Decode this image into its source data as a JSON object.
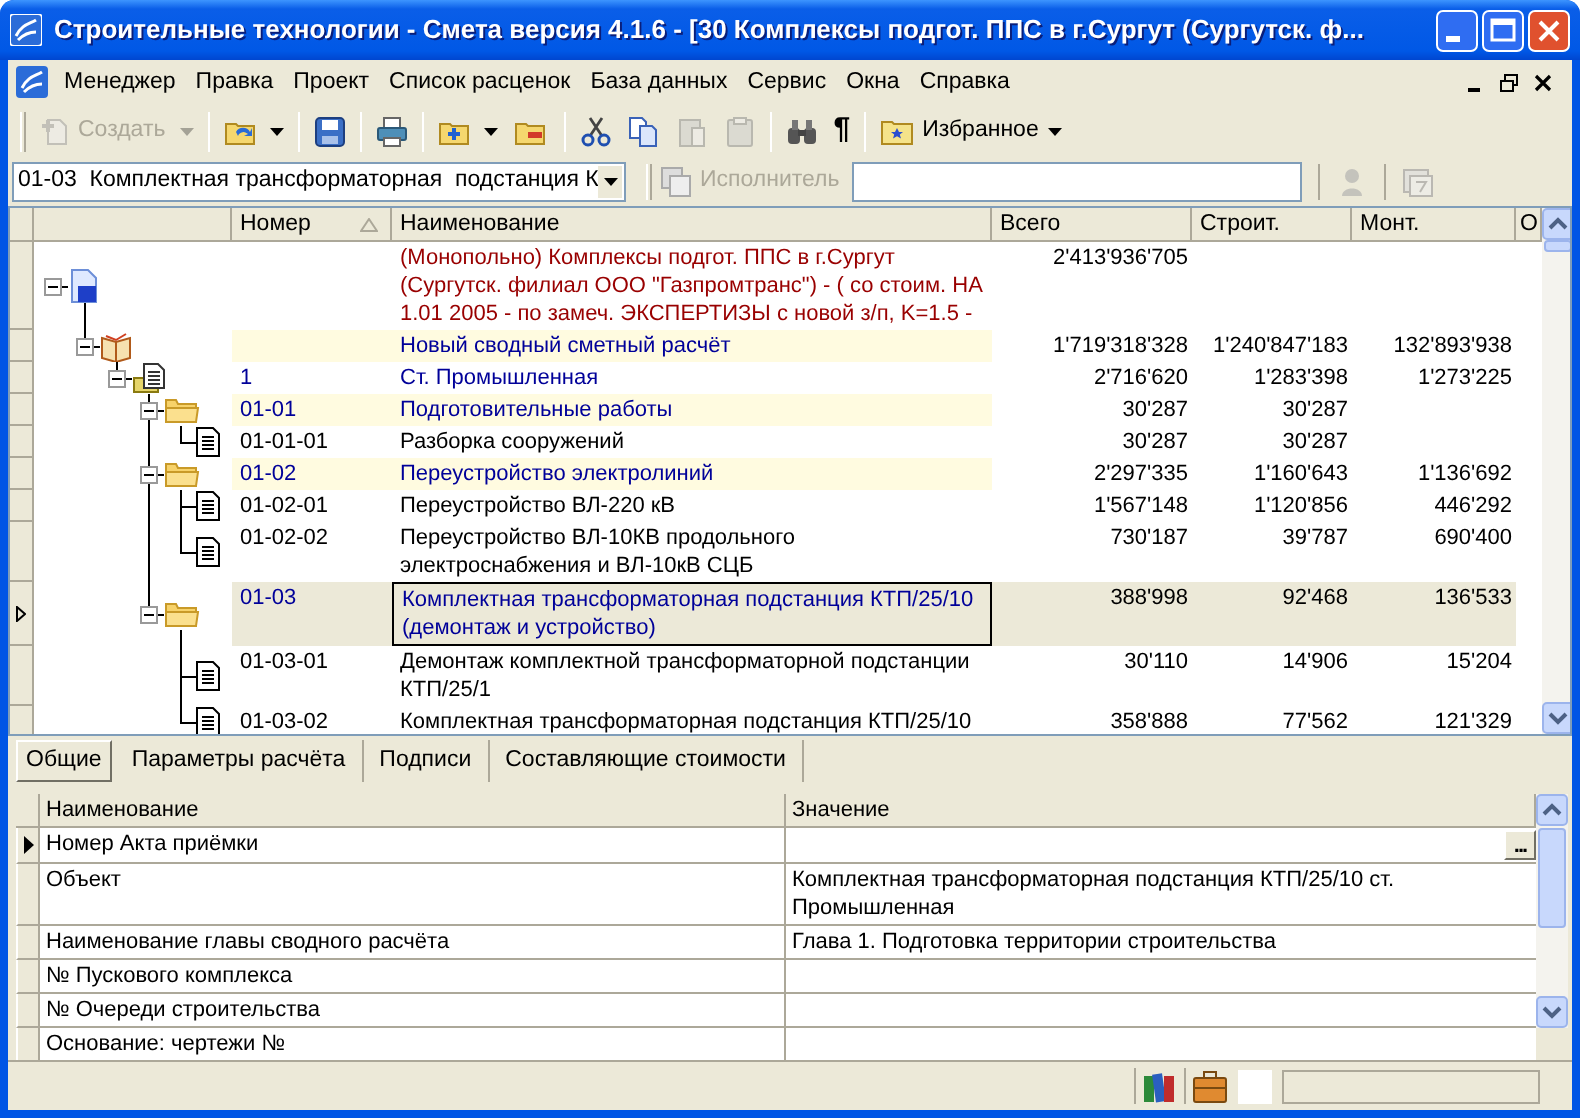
{
  "window": {
    "title": "Строительные технологии - Смета  версия 4.1.6 - [30  Комплексы  подгот. ППС в г.Сургут  (Сургутск. ф..."
  },
  "menu": [
    "Менеджер",
    "Правка",
    "Проект",
    "Список расценок",
    "База данных",
    "Сервис",
    "Окна",
    "Справка"
  ],
  "toolbar": [
    {
      "kind": "create",
      "label": "Создать",
      "disabled": true,
      "dropdown": true
    },
    {
      "kind": "separator"
    },
    {
      "kind": "open",
      "disabled": false,
      "dropdown": true
    },
    {
      "kind": "separator"
    },
    {
      "kind": "save",
      "disabled": false,
      "dropdown": false
    },
    {
      "kind": "separator"
    },
    {
      "kind": "print",
      "disabled": false,
      "dropdown": false
    },
    {
      "kind": "separator"
    },
    {
      "kind": "add",
      "disabled": false,
      "dropdown": true
    },
    {
      "kind": "folder",
      "disabled": false,
      "dropdown": false
    },
    {
      "kind": "separator"
    },
    {
      "kind": "cut",
      "disabled": false,
      "dropdown": false
    },
    {
      "kind": "copy",
      "disabled": false,
      "dropdown": false
    },
    {
      "kind": "paste",
      "disabled": true,
      "dropdown": false
    },
    {
      "kind": "clipboard",
      "disabled": true,
      "dropdown": false
    },
    {
      "kind": "separator"
    },
    {
      "kind": "find",
      "disabled": false,
      "dropdown": false
    },
    {
      "kind": "text",
      "label": "¶",
      "disabled": false,
      "dropdown": false
    },
    {
      "kind": "separator"
    },
    {
      "kind": "favorites",
      "label": "Избранное",
      "disabled": false,
      "dropdown": true
    }
  ],
  "filter_bar": {
    "combo": {
      "value": "01-03  Комплектная трансформаторная  подстанция К"
    },
    "executor": {
      "label": "Исполнитель",
      "disabled": true
    },
    "buttons": [
      {
        "kind": "person",
        "disabled": true
      },
      {
        "kind": "calendar",
        "disabled": true
      }
    ]
  },
  "estimate_tree": {
    "columns": [
      {
        "label": "Номер",
        "sorted": true
      },
      {
        "label": "Наименование",
        "sorted": false
      },
      {
        "label": "Всего",
        "sorted": false
      },
      {
        "label": "Строит.",
        "sorted": false
      },
      {
        "label": "Монт.",
        "sorted": false
      },
      {
        "label": "О"
      }
    ],
    "rows": [
      {
        "kind": "estimate",
        "expanded": true,
        "selected": false,
        "name": "(Монопольно) Комплексы  подгот. ППС в г.Сургут (Сургутск. филиал ООО \"Газпромтранс\") - ( со стоим.  НА 1.01 2005 - по замеч. ЭКСПЕРТИЗЫ с новой з/п, K=1.5 -",
        "total": "2'413'936'705",
        "children": [
          {
            "kind": "summary",
            "expanded": true,
            "selected": false,
            "name": "Новый сводный сметный расчёт",
            "total": "1'719'318'328",
            "construction": "1'240'847'183",
            "installation": "132'893'938",
            "children": [
              {
                "kind": "object",
                "expanded": true,
                "selected": false,
                "number": "1",
                "name": "Ст. Промышленная",
                "total": "2'716'620",
                "construction": "1'283'398",
                "installation": "1'273'225",
                "children": [
                  {
                    "kind": "section",
                    "expanded": true,
                    "selected": false,
                    "number": "01-01",
                    "name": "Подготовительные работы",
                    "total": "30'287",
                    "construction": "30'287",
                    "children": [
                      {
                        "kind": "item",
                        "selected": false,
                        "number": "01-01-01",
                        "name": "Разборка сооружений",
                        "total": "30'287",
                        "construction": "30'287"
                      }
                    ]
                  },
                  {
                    "kind": "section",
                    "expanded": true,
                    "selected": false,
                    "number": "01-02",
                    "name": "Переустройство электролиний",
                    "total": "2'297'335",
                    "construction": "1'160'643",
                    "installation": "1'136'692",
                    "children": [
                      {
                        "kind": "item",
                        "selected": false,
                        "number": "01-02-01",
                        "name": "Переустройство ВЛ-220 кВ",
                        "total": "1'567'148",
                        "construction": "1'120'856",
                        "installation": "446'292"
                      },
                      {
                        "kind": "item",
                        "selected": false,
                        "number": "01-02-02",
                        "name": "Переустройство ВЛ-10КВ продольного электроснабжения и ВЛ-10кВ СЦБ",
                        "total": "730'187",
                        "construction": "39'787",
                        "installation": "690'400"
                      }
                    ]
                  },
                  {
                    "kind": "section",
                    "expanded": true,
                    "selected": true,
                    "number": "01-03",
                    "name": "Комплектная трансформаторная  подстанция КТП/25/10 (демонтаж и устройство)",
                    "total": "388'998",
                    "construction": "92'468",
                    "installation": "136'533",
                    "children": [
                      {
                        "kind": "item",
                        "selected": false,
                        "number": "01-03-01",
                        "name": "Демонтаж комплектной трансформаторной  подстанции КТП/25/1",
                        "total": "30'110",
                        "construction": "14'906",
                        "installation": "15'204"
                      },
                      {
                        "kind": "item",
                        "selected": false,
                        "number": "01-03-02",
                        "name": "Комплектная трансформаторная  подстанция КТП/25/10",
                        "total": "358'888",
                        "construction": "77'562",
                        "installation": "121'329"
                      }
                    ]
                  }
                ]
              }
            ]
          }
        ]
      }
    ]
  },
  "tabs": [
    {
      "label": "Общие",
      "selected": true
    },
    {
      "label": "Параметры расчёта",
      "selected": false
    },
    {
      "label": "Подписи",
      "selected": false
    },
    {
      "label": "Составляющие стоимости",
      "selected": false
    }
  ],
  "properties": {
    "columns": [
      "Наименование",
      "Значение"
    ],
    "rows": [
      {
        "name": "Номер Акта приёмки",
        "current": true,
        "button_label": "..."
      },
      {
        "name": "Объект",
        "current": false,
        "value": "Комплектная трансформаторная  подстанция КТП/25/10  ст. Промышленная"
      },
      {
        "name": "Наименование главы сводного расчёта",
        "current": false,
        "value": "Глава 1. Подготовка территории строительства"
      },
      {
        "name": "№ Пускового комплекса",
        "current": false
      },
      {
        "name": "№ Очереди строительства",
        "current": false
      },
      {
        "name": "Основание: чертежи №",
        "current": false
      }
    ]
  }
}
